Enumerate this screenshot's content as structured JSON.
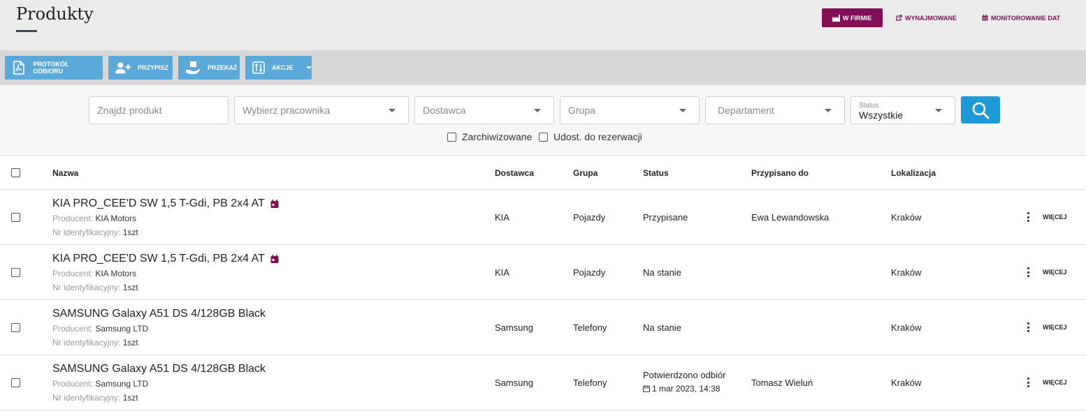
{
  "header": {
    "title": "Produkty",
    "views": [
      {
        "label": "W FIRMIE",
        "icon": "factory-icon"
      },
      {
        "label": "WYNAJMOWANE",
        "icon": "external-link-icon"
      },
      {
        "label": "MONITOROWANIE DAT",
        "icon": "calendar-icon"
      }
    ]
  },
  "toolbar": {
    "protocol_label": "PROTOKÓŁ ODBIORU",
    "assign_label": "PRZYPISZ",
    "transfer_label": "PRZEKAŻ",
    "actions_label": "AKCJE"
  },
  "filters": {
    "search_placeholder": "Znajdź produkt",
    "employee_placeholder": "Wybierz pracownika",
    "supplier_placeholder": "Dostawca",
    "group_placeholder": "Grupa",
    "department_placeholder": "Departament",
    "status_label": "Status",
    "status_value": "Wszystkie",
    "archived_label": "Zarchiwizowane",
    "reservation_label": "Udost. do rezerwacji"
  },
  "table": {
    "columns": {
      "name": "Nazwa",
      "supplier": "Dostawca",
      "group": "Grupa",
      "status": "Status",
      "assigned": "Przypisano do",
      "location": "Lokalizacja"
    },
    "producer_label": "Producent:",
    "id_label": "Nr identyfikacyjny:",
    "more_label": "WIĘCEJ",
    "rows": [
      {
        "name": "KIA PRO_CEE'D SW 1,5 T-Gdi, PB 2x4 AT",
        "producer": "KIA Motors",
        "id": "1szt",
        "supplier": "KIA",
        "group": "Pojazdy",
        "status": "Przypisane",
        "status_date": "",
        "assigned": "Ewa Lewandowska",
        "location": "Kraków"
      },
      {
        "name": "KIA PRO_CEE'D SW 1,5 T-Gdi, PB 2x4 AT",
        "producer": "KIA Motors",
        "id": "1szt",
        "supplier": "KIA",
        "group": "Pojazdy",
        "status": "Na stanie",
        "status_date": "",
        "assigned": "",
        "location": "Kraków"
      },
      {
        "name": "SAMSUNG Galaxy A51 DS 4/128GB Black",
        "producer": "Samsung LTD",
        "id": "1szt",
        "supplier": "Samsung",
        "group": "Telefony",
        "status": "Na stanie",
        "status_date": "",
        "assigned": "",
        "location": "Kraków"
      },
      {
        "name": "SAMSUNG Galaxy A51 DS 4/128GB Black",
        "producer": "Samsung LTD",
        "id": "1szt",
        "supplier": "Samsung",
        "group": "Telefony",
        "status": "Potwierdzono odbiór",
        "status_date": "1 mar 2023, 14:38",
        "assigned": "Tomasz Wieluń",
        "location": "Kraków"
      }
    ]
  },
  "colors": {
    "brand": "#820f55",
    "toolbar_button": "#5aa9d8",
    "search_button": "#1e9ad6"
  }
}
